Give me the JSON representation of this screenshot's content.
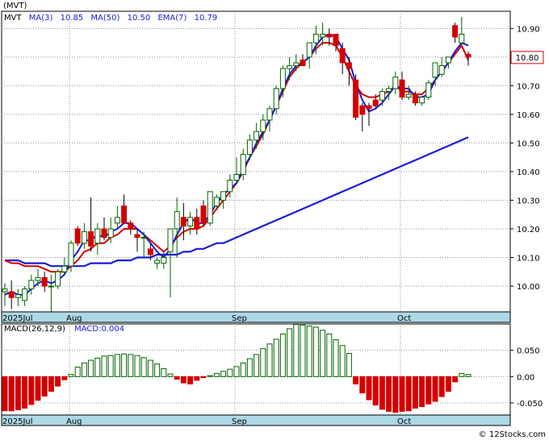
{
  "colors": {
    "up": "#006400",
    "down": "#d40000",
    "ma3": "#d40000",
    "ma": "#1a1adc",
    "grid": "#909090",
    "axis_band": "#add8e6"
  },
  "chart_data": [
    {
      "type": "candlestick",
      "legend": {
        "symbol": "(MVT)",
        "ticker": "MVT",
        "ma3_label": "MA(3)",
        "ma3_value": "10.85",
        "ma50_label": "MA(50)",
        "ma50_value": "10.50",
        "ema7_label": "EMA(7)",
        "ema7_value": "10.79"
      },
      "last_price": "10.80",
      "ylim": [
        9.91,
        10.96
      ],
      "yticks": [
        "10.00",
        "10.10",
        "10.20",
        "10.30",
        "10.40",
        "10.50",
        "10.60",
        "10.70",
        "10.80",
        "10.90"
      ],
      "xlabels": [
        {
          "label": "2025Jul",
          "index": 0
        },
        {
          "label": "Aug",
          "index": 10
        },
        {
          "label": "Sep",
          "index": 35
        },
        {
          "label": "Oct",
          "index": 60
        }
      ],
      "candles": [
        [
          9.98,
          10.01,
          9.93,
          9.99
        ],
        [
          9.98,
          10.02,
          9.92,
          9.96
        ],
        [
          9.96,
          9.99,
          9.93,
          9.97
        ],
        [
          9.95,
          10.0,
          9.93,
          9.99
        ],
        [
          9.99,
          10.04,
          9.97,
          10.02
        ],
        [
          10.02,
          10.06,
          10.0,
          10.03
        ],
        [
          10.03,
          10.05,
          9.98,
          10.0
        ],
        [
          10.0,
          10.04,
          9.91,
          10.0
        ],
        [
          10.0,
          10.06,
          9.99,
          10.05
        ],
        [
          10.05,
          10.1,
          10.04,
          10.07
        ],
        [
          10.07,
          10.16,
          10.05,
          10.15
        ],
        [
          10.2,
          10.21,
          10.14,
          10.15
        ],
        [
          10.15,
          10.22,
          10.13,
          10.19
        ],
        [
          10.19,
          10.31,
          10.12,
          10.14
        ],
        [
          10.15,
          10.22,
          10.11,
          10.2
        ],
        [
          10.2,
          10.24,
          10.16,
          10.17
        ],
        [
          10.17,
          10.24,
          10.15,
          10.2
        ],
        [
          10.22,
          10.28,
          10.2,
          10.24
        ],
        [
          10.28,
          10.32,
          10.22,
          10.22
        ],
        [
          10.22,
          10.23,
          10.18,
          10.2
        ],
        [
          10.18,
          10.2,
          10.12,
          10.17
        ],
        [
          10.17,
          10.19,
          10.1,
          10.17
        ],
        [
          10.13,
          10.15,
          10.09,
          10.11
        ],
        [
          10.08,
          10.1,
          10.06,
          10.09
        ],
        [
          10.08,
          10.12,
          10.06,
          10.1
        ],
        [
          10.12,
          10.2,
          9.96,
          10.2
        ],
        [
          10.2,
          10.31,
          10.1,
          10.26
        ],
        [
          10.24,
          10.29,
          10.16,
          10.21
        ],
        [
          10.21,
          10.26,
          10.18,
          10.24
        ],
        [
          10.24,
          10.27,
          10.18,
          10.2
        ],
        [
          10.28,
          10.3,
          10.21,
          10.22
        ],
        [
          10.22,
          10.32,
          10.21,
          10.33
        ],
        [
          10.28,
          10.32,
          10.27,
          10.31
        ],
        [
          10.3,
          10.32,
          10.27,
          10.33
        ],
        [
          10.33,
          10.39,
          10.31,
          10.37
        ],
        [
          10.37,
          10.45,
          10.36,
          10.39
        ],
        [
          10.39,
          10.48,
          10.37,
          10.46
        ],
        [
          10.46,
          10.53,
          10.44,
          10.51
        ],
        [
          10.51,
          10.57,
          10.48,
          10.54
        ],
        [
          10.54,
          10.6,
          10.51,
          10.58
        ],
        [
          10.58,
          10.63,
          10.54,
          10.62
        ],
        [
          10.62,
          10.7,
          10.6,
          10.69
        ],
        [
          10.69,
          10.77,
          10.66,
          10.76
        ],
        [
          10.76,
          10.8,
          10.72,
          10.77
        ],
        [
          10.77,
          10.81,
          10.75,
          10.78
        ],
        [
          10.79,
          10.81,
          10.77,
          10.77
        ],
        [
          10.8,
          10.84,
          10.76,
          10.85
        ],
        [
          10.85,
          10.91,
          10.81,
          10.88
        ],
        [
          10.87,
          10.92,
          10.84,
          10.88
        ],
        [
          10.88,
          10.9,
          10.84,
          10.87
        ],
        [
          10.88,
          10.88,
          10.82,
          10.84
        ],
        [
          10.83,
          10.85,
          10.74,
          10.78
        ],
        [
          10.78,
          10.8,
          10.7,
          10.76
        ],
        [
          10.72,
          10.74,
          10.58,
          10.59
        ],
        [
          10.63,
          10.64,
          10.54,
          10.6
        ],
        [
          10.63,
          10.64,
          10.56,
          10.62
        ],
        [
          10.65,
          10.67,
          10.62,
          10.63
        ],
        [
          10.65,
          10.69,
          10.63,
          10.68
        ],
        [
          10.68,
          10.7,
          10.65,
          10.69
        ],
        [
          10.69,
          10.75,
          10.67,
          10.73
        ],
        [
          10.72,
          10.75,
          10.65,
          10.66
        ],
        [
          10.66,
          10.7,
          10.65,
          10.67
        ],
        [
          10.67,
          10.68,
          10.63,
          10.64
        ],
        [
          10.64,
          10.66,
          10.63,
          10.66
        ],
        [
          10.66,
          10.72,
          10.65,
          10.71
        ],
        [
          10.73,
          10.76,
          10.7,
          10.78
        ],
        [
          10.74,
          10.8,
          10.73,
          10.77
        ],
        [
          10.78,
          10.8,
          10.76,
          10.8
        ],
        [
          10.91,
          10.92,
          10.85,
          10.87
        ],
        [
          10.85,
          10.94,
          10.84,
          10.88
        ],
        [
          10.81,
          10.82,
          10.77,
          10.8
        ]
      ],
      "ma3": [
        9.97,
        9.98,
        9.97,
        9.97,
        9.99,
        10.01,
        10.02,
        10.01,
        10.02,
        10.04,
        10.09,
        10.12,
        10.16,
        10.16,
        10.18,
        10.17,
        10.19,
        10.2,
        10.22,
        10.22,
        10.2,
        10.18,
        10.15,
        10.12,
        10.1,
        10.13,
        10.18,
        10.22,
        10.24,
        10.22,
        10.22,
        10.25,
        10.29,
        10.32,
        10.34,
        10.36,
        10.41,
        10.45,
        10.5,
        10.54,
        10.58,
        10.63,
        10.69,
        10.74,
        10.77,
        10.78,
        10.8,
        10.84,
        10.87,
        10.88,
        10.87,
        10.83,
        10.79,
        10.71,
        10.65,
        10.61,
        10.62,
        10.64,
        10.67,
        10.7,
        10.69,
        10.69,
        10.66,
        10.66,
        10.67,
        10.72,
        10.75,
        10.78,
        10.82,
        10.85,
        10.84
      ],
      "ma50": [
        10.09,
        10.09,
        10.09,
        10.08,
        10.08,
        10.08,
        10.08,
        10.07,
        10.07,
        10.07,
        10.07,
        10.07,
        10.07,
        10.08,
        10.08,
        10.08,
        10.08,
        10.09,
        10.09,
        10.09,
        10.1,
        10.1,
        10.1,
        10.11,
        10.11,
        10.11,
        10.11,
        10.12,
        10.12,
        10.13,
        10.13,
        10.14,
        10.15,
        10.15,
        10.16,
        10.17,
        10.18,
        10.19,
        10.2,
        10.21,
        10.22,
        10.23,
        10.24,
        10.25,
        10.26,
        10.27,
        10.28,
        10.29,
        10.3,
        10.31,
        10.32,
        10.33,
        10.34,
        10.35,
        10.36,
        10.37,
        10.38,
        10.39,
        10.4,
        10.41,
        10.42,
        10.43,
        10.44,
        10.45,
        10.46,
        10.47,
        10.48,
        10.49,
        10.5,
        10.51,
        10.52
      ],
      "ema7": [
        10.09,
        10.08,
        10.08,
        10.07,
        10.07,
        10.07,
        10.06,
        10.05,
        10.05,
        10.05,
        10.07,
        10.09,
        10.12,
        10.13,
        10.15,
        10.15,
        10.17,
        10.18,
        10.2,
        10.2,
        10.2,
        10.18,
        10.16,
        10.14,
        10.12,
        10.14,
        10.17,
        10.19,
        10.2,
        10.2,
        10.21,
        10.24,
        10.27,
        10.3,
        10.33,
        10.36,
        10.4,
        10.45,
        10.49,
        10.53,
        10.58,
        10.63,
        10.68,
        10.73,
        10.76,
        10.78,
        10.8,
        10.83,
        10.85,
        10.85,
        10.84,
        10.8,
        10.75,
        10.7,
        10.67,
        10.66,
        10.66,
        10.67,
        10.68,
        10.7,
        10.68,
        10.68,
        10.67,
        10.67,
        10.69,
        10.72,
        10.75,
        10.78,
        10.81,
        10.84,
        10.79
      ]
    },
    {
      "type": "bar",
      "title": "MACD(26,12,9)",
      "value_label": "MACD:0.004",
      "ylim": [
        -0.073,
        0.1
      ],
      "yticks": [
        "0.050",
        "0.00",
        "-0.050"
      ],
      "xlabels": [
        {
          "label": "2025Jul",
          "index": 0
        },
        {
          "label": "Aug",
          "index": 10
        },
        {
          "label": "Sep",
          "index": 35
        },
        {
          "label": "Oct",
          "index": 60
        }
      ],
      "values": [
        -0.065,
        -0.065,
        -0.063,
        -0.06,
        -0.053,
        -0.045,
        -0.037,
        -0.028,
        -0.018,
        -0.006,
        0.004,
        0.018,
        0.026,
        0.031,
        0.035,
        0.039,
        0.04,
        0.042,
        0.043,
        0.042,
        0.04,
        0.036,
        0.031,
        0.024,
        0.015,
        0.005,
        -0.005,
        -0.012,
        -0.014,
        -0.007,
        -0.002,
        0.002,
        0.006,
        0.01,
        0.014,
        0.019,
        0.026,
        0.034,
        0.042,
        0.053,
        0.062,
        0.071,
        0.081,
        0.091,
        0.099,
        0.098,
        0.096,
        0.094,
        0.088,
        0.081,
        0.07,
        0.059,
        0.044,
        -0.014,
        -0.031,
        -0.044,
        -0.054,
        -0.062,
        -0.066,
        -0.068,
        -0.066,
        -0.065,
        -0.06,
        -0.057,
        -0.052,
        -0.047,
        -0.038,
        -0.028,
        -0.01,
        0.006,
        0.004
      ]
    }
  ],
  "credit": "© 12Stocks.com"
}
